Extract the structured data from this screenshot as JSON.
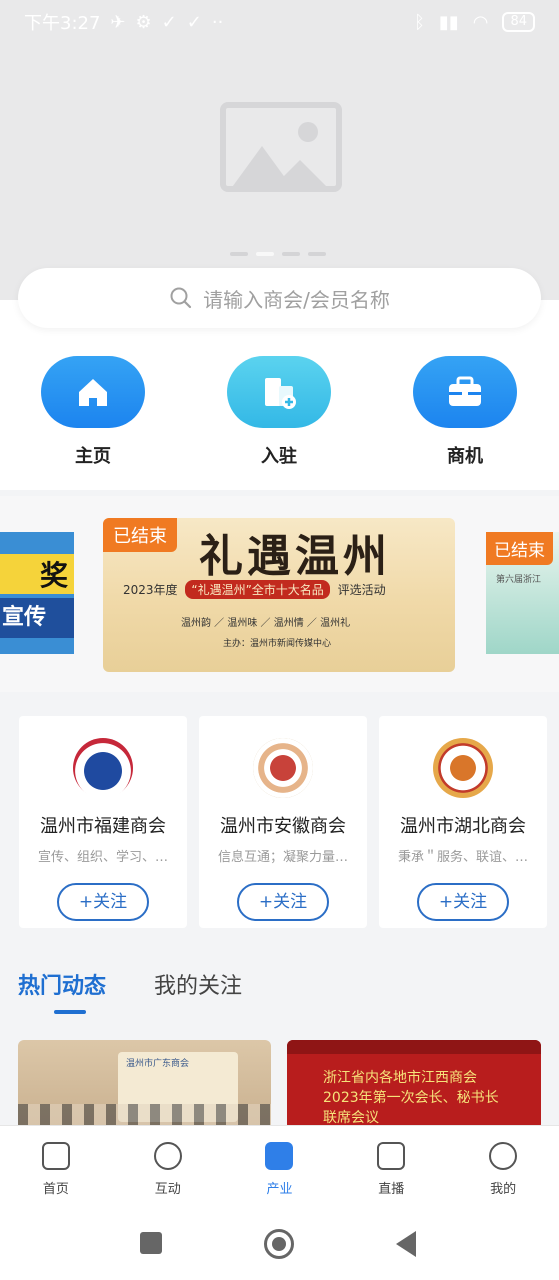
{
  "status_bar": {
    "time": "下午3:27",
    "extra": "··",
    "battery": "84"
  },
  "search": {
    "placeholder": "请输入商会/会员名称"
  },
  "quick_entries": [
    {
      "label": "主页",
      "icon": "home-icon"
    },
    {
      "label": "入驻",
      "icon": "building-add-icon"
    },
    {
      "label": "商机",
      "icon": "briefcase-icon"
    }
  ],
  "carousel": {
    "left_card": {
      "line1": "奖",
      "line2": "宣传"
    },
    "main_card": {
      "status": "已结束",
      "title": "礼遇温州",
      "subtitle_pre": "2023年度",
      "subtitle_highlight": "“礼遇温州”全市十大名品",
      "subtitle_post": "评选活动",
      "tags": "温州韵 ／ 温州味 ／ 温州情 ／ 温州礼",
      "host": "主办：温州市新闻传媒中心"
    },
    "right_card": {
      "status": "已结束",
      "subtitle": "第六届浙江"
    }
  },
  "chambers": [
    {
      "name": "温州市福建商会",
      "desc": "宣传、组织、学习、…",
      "follow": "+关注"
    },
    {
      "name": "温州市安徽商会",
      "desc": "信息互通；凝聚力量…",
      "follow": "+关注"
    },
    {
      "name": "温州市湖北商会",
      "desc": "秉承＂服务、联谊、…",
      "follow": "+关注"
    }
  ],
  "tabs": {
    "hot": "热门动态",
    "following": "我的关注"
  },
  "feed": [
    {
      "sign_text": "温州市广东商会"
    },
    {
      "line1": "浙江省内各地市江西商会",
      "line2": "2023年第一次会长、秘书长",
      "line3": "联席会议"
    }
  ],
  "tabbar": [
    {
      "label": "首页",
      "icon": "home-tab-icon"
    },
    {
      "label": "互动",
      "icon": "chat-tab-icon"
    },
    {
      "label": "产业",
      "icon": "industry-tab-icon"
    },
    {
      "label": "直播",
      "icon": "live-tab-icon"
    },
    {
      "label": "我的",
      "icon": "profile-tab-icon"
    }
  ],
  "colors": {
    "primary": "#1f6fd1",
    "accent_orange": "#f07a22",
    "follow_border": "#2b6ec6"
  }
}
